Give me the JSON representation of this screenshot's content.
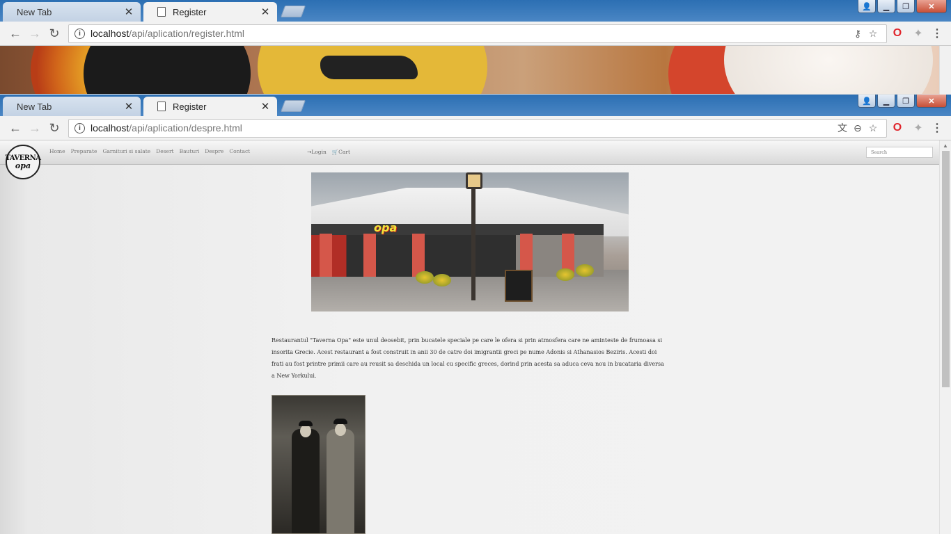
{
  "window1": {
    "tabs": [
      {
        "title": "New Tab"
      },
      {
        "title": "Register"
      }
    ],
    "url_host": "localhost",
    "url_path": "/api/aplication/register.html"
  },
  "window2": {
    "tabs": [
      {
        "title": "New Tab"
      },
      {
        "title": "Register"
      }
    ],
    "url_host": "localhost",
    "url_path": "/api/aplication/despre.html"
  },
  "site": {
    "logo_line1": "TAVERNA",
    "logo_line2": "opa",
    "nav": [
      "Home",
      "Preparate",
      "Garnituri si salate",
      "Desert",
      "Bauturi",
      "Despre",
      "Contact"
    ],
    "login": "Login",
    "cart": "Cart",
    "search_placeholder": "Search",
    "hero_sign": "opa",
    "article": "Restaurantul \"Taverna Opa\" este unul deosebit, prin bucatele speciale pe care le ofera si prin atmosfera care ne aminteste de frumoasa si insorita Grecie. Acest restaurant a fost construit in anii 30 de catre doi imigrantii greci pe nume Adonis si Athanasios Beziris. Acesti doi frati au fost printre primii care au reusit sa deschida un local cu specific greces, dorind prin acesta sa aduca ceva nou in bucataria diversa a New Yorkului."
  }
}
